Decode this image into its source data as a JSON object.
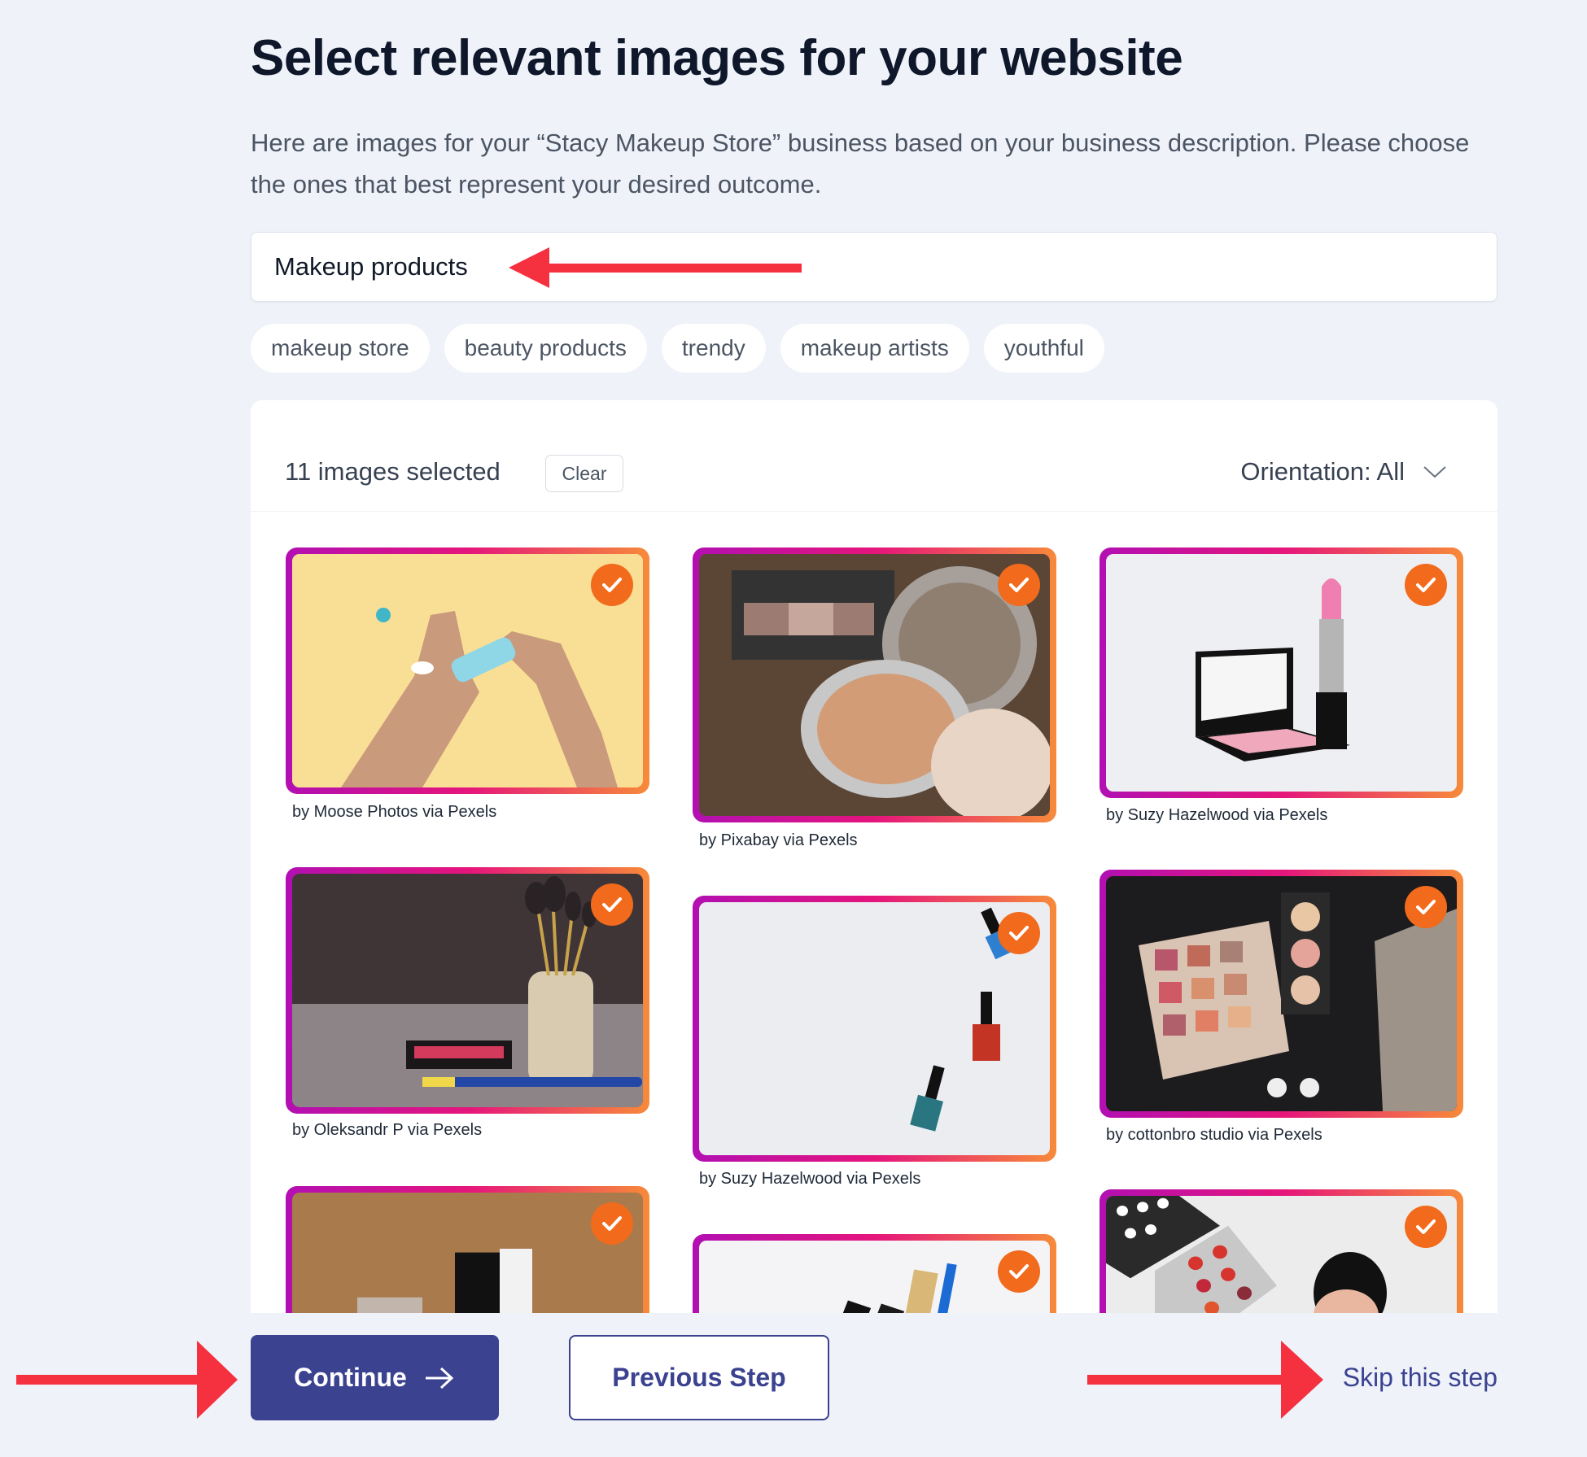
{
  "page": {
    "title": "Select relevant images for your website",
    "subtitle": "Here are images for your “Stacy Makeup Store” business based on your business description. Please choose the ones that best represent your desired outcome."
  },
  "search": {
    "value": "Makeup products"
  },
  "chips": [
    "makeup store",
    "beauty products",
    "trendy",
    "makeup artists",
    "youthful"
  ],
  "gallery": {
    "selected_count_label": "11 images selected",
    "clear_label": "Clear",
    "orientation_label": "Orientation: All",
    "orientation_icon": "chevron-down-icon",
    "check_icon": "checkmark-icon",
    "colors": {
      "badge": "#f26a1b",
      "border_gradient": [
        "#b20fb2",
        "#e5157c",
        "#f78a3a"
      ]
    },
    "images": [
      {
        "caption": "by Moose Photos via Pexels",
        "subject": "hands applying cream on yellow background",
        "selected": true
      },
      {
        "caption": "by Pixabay via Pexels",
        "subject": "powder compact and eyeshadow on wood",
        "selected": true
      },
      {
        "caption": "by Suzy Hazelwood via Pexels",
        "subject": "pink lipstick and blush compact",
        "selected": true
      },
      {
        "caption": "by Oleksandr P via Pexels",
        "subject": "makeup brushes in holder",
        "selected": true
      },
      {
        "caption": "by Suzy Hazelwood via Pexels",
        "subject": "nail polish bottles on white",
        "selected": true
      },
      {
        "caption": "by cottonbro studio via Pexels",
        "subject": "eyeshadow palette on black",
        "selected": true
      },
      {
        "caption": "",
        "subject": "bottle on brown background",
        "selected": true
      },
      {
        "caption": "",
        "subject": "mascara and pencils",
        "selected": true
      },
      {
        "caption": "",
        "subject": "lipstick palette and compact",
        "selected": true
      }
    ]
  },
  "footer": {
    "continue_label": "Continue",
    "continue_icon": "arrow-right-icon",
    "previous_label": "Previous Step",
    "skip_label": "Skip this step"
  },
  "colors": {
    "background": "#eff2f9",
    "primary": "#3b4290",
    "annotation_arrow": "#f5303f"
  }
}
